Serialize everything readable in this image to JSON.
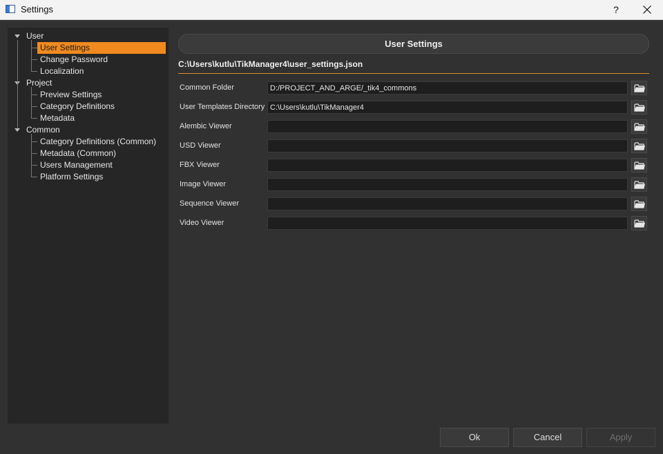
{
  "window": {
    "title": "Settings",
    "help_label": "?"
  },
  "tree": [
    {
      "label": "User",
      "level": 0
    },
    {
      "label": "User Settings",
      "level": 1,
      "selected": true
    },
    {
      "label": "Change Password",
      "level": 1
    },
    {
      "label": "Localization",
      "level": 1
    },
    {
      "label": "Project",
      "level": 0
    },
    {
      "label": "Preview Settings",
      "level": 1
    },
    {
      "label": "Category Definitions",
      "level": 1
    },
    {
      "label": "Metadata",
      "level": 1
    },
    {
      "label": "Common",
      "level": 0
    },
    {
      "label": "Category Definitions (Common)",
      "level": 1
    },
    {
      "label": "Metadata (Common)",
      "level": 1
    },
    {
      "label": "Users Management",
      "level": 1
    },
    {
      "label": "Platform Settings",
      "level": 1
    }
  ],
  "main": {
    "header": "User Settings",
    "path": "C:\\Users\\kutlu\\TikManager4\\user_settings.json",
    "fields": [
      {
        "label": "Common Folder",
        "value": "D:/PROJECT_AND_ARGE/_tik4_commons"
      },
      {
        "label": "User Templates Directory",
        "value": "C:\\Users\\kutlu\\TikManager4"
      },
      {
        "label": "Alembic Viewer",
        "value": ""
      },
      {
        "label": "USD Viewer",
        "value": ""
      },
      {
        "label": "FBX Viewer",
        "value": ""
      },
      {
        "label": "Image Viewer",
        "value": ""
      },
      {
        "label": "Sequence Viewer",
        "value": ""
      },
      {
        "label": "Video Viewer",
        "value": ""
      }
    ]
  },
  "buttons": {
    "ok": "Ok",
    "cancel": "Cancel",
    "apply": "Apply"
  },
  "colors": {
    "accent": "#f08a1f",
    "background": "#313131",
    "panel": "#262626"
  }
}
